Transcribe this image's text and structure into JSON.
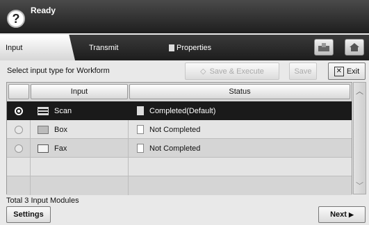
{
  "header": {
    "status": "Ready",
    "help_glyph": "?"
  },
  "tabs": [
    {
      "label": "Input",
      "active": true
    },
    {
      "label": "Transmit",
      "active": false
    },
    {
      "label": "Properties",
      "active": false
    }
  ],
  "toolbar": {
    "instruction": "Select input type for Workform",
    "save_execute": "Save & Execute",
    "save": "Save",
    "exit": "Exit"
  },
  "table": {
    "columns": [
      "Input",
      "Status"
    ],
    "rows": [
      {
        "input": "Scan",
        "status": "Completed(Default)",
        "icon": "scanner-icon",
        "selected": true
      },
      {
        "input": "Box",
        "status": "Not Completed",
        "icon": "box-icon",
        "selected": false
      },
      {
        "input": "Fax",
        "status": "Not Completed",
        "icon": "fax-icon",
        "selected": false
      }
    ]
  },
  "footer": {
    "total": "Total 3 Input Modules",
    "settings": "Settings",
    "next": "Next"
  },
  "colors": {
    "selected_row": "#1a1a1a",
    "header_bg": "#2a2a2a"
  }
}
